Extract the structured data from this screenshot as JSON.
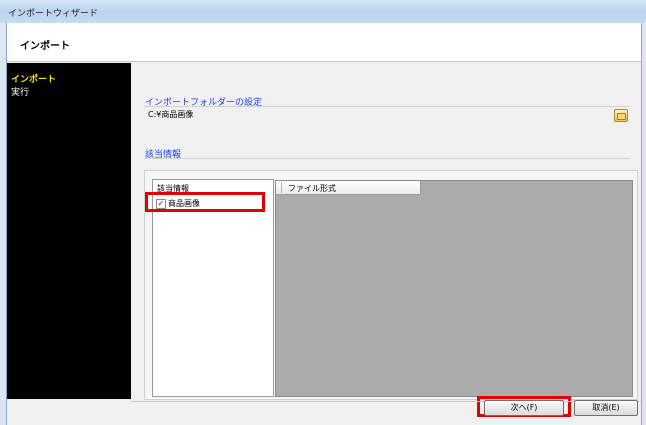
{
  "window": {
    "title": "インポートウィザード"
  },
  "header": {
    "title": "インポート"
  },
  "sidebar": {
    "steps": [
      {
        "label": "インポート",
        "active": true
      },
      {
        "label": "実行",
        "active": false
      }
    ]
  },
  "folder_group": {
    "label": "インポートフォルダーの設定",
    "path": "C:¥商品画像"
  },
  "info_group": {
    "label": "該当情報",
    "list_header": "該当情報",
    "items": [
      {
        "label": "商品画像",
        "checked": true
      }
    ],
    "grid_column": "ファイル形式"
  },
  "buttons": {
    "next": "次へ(F)",
    "cancel": "取消(E)"
  },
  "colors": {
    "highlight": "#e00000",
    "active_step": "#ffe600",
    "group_label": "#1f3fe0"
  }
}
